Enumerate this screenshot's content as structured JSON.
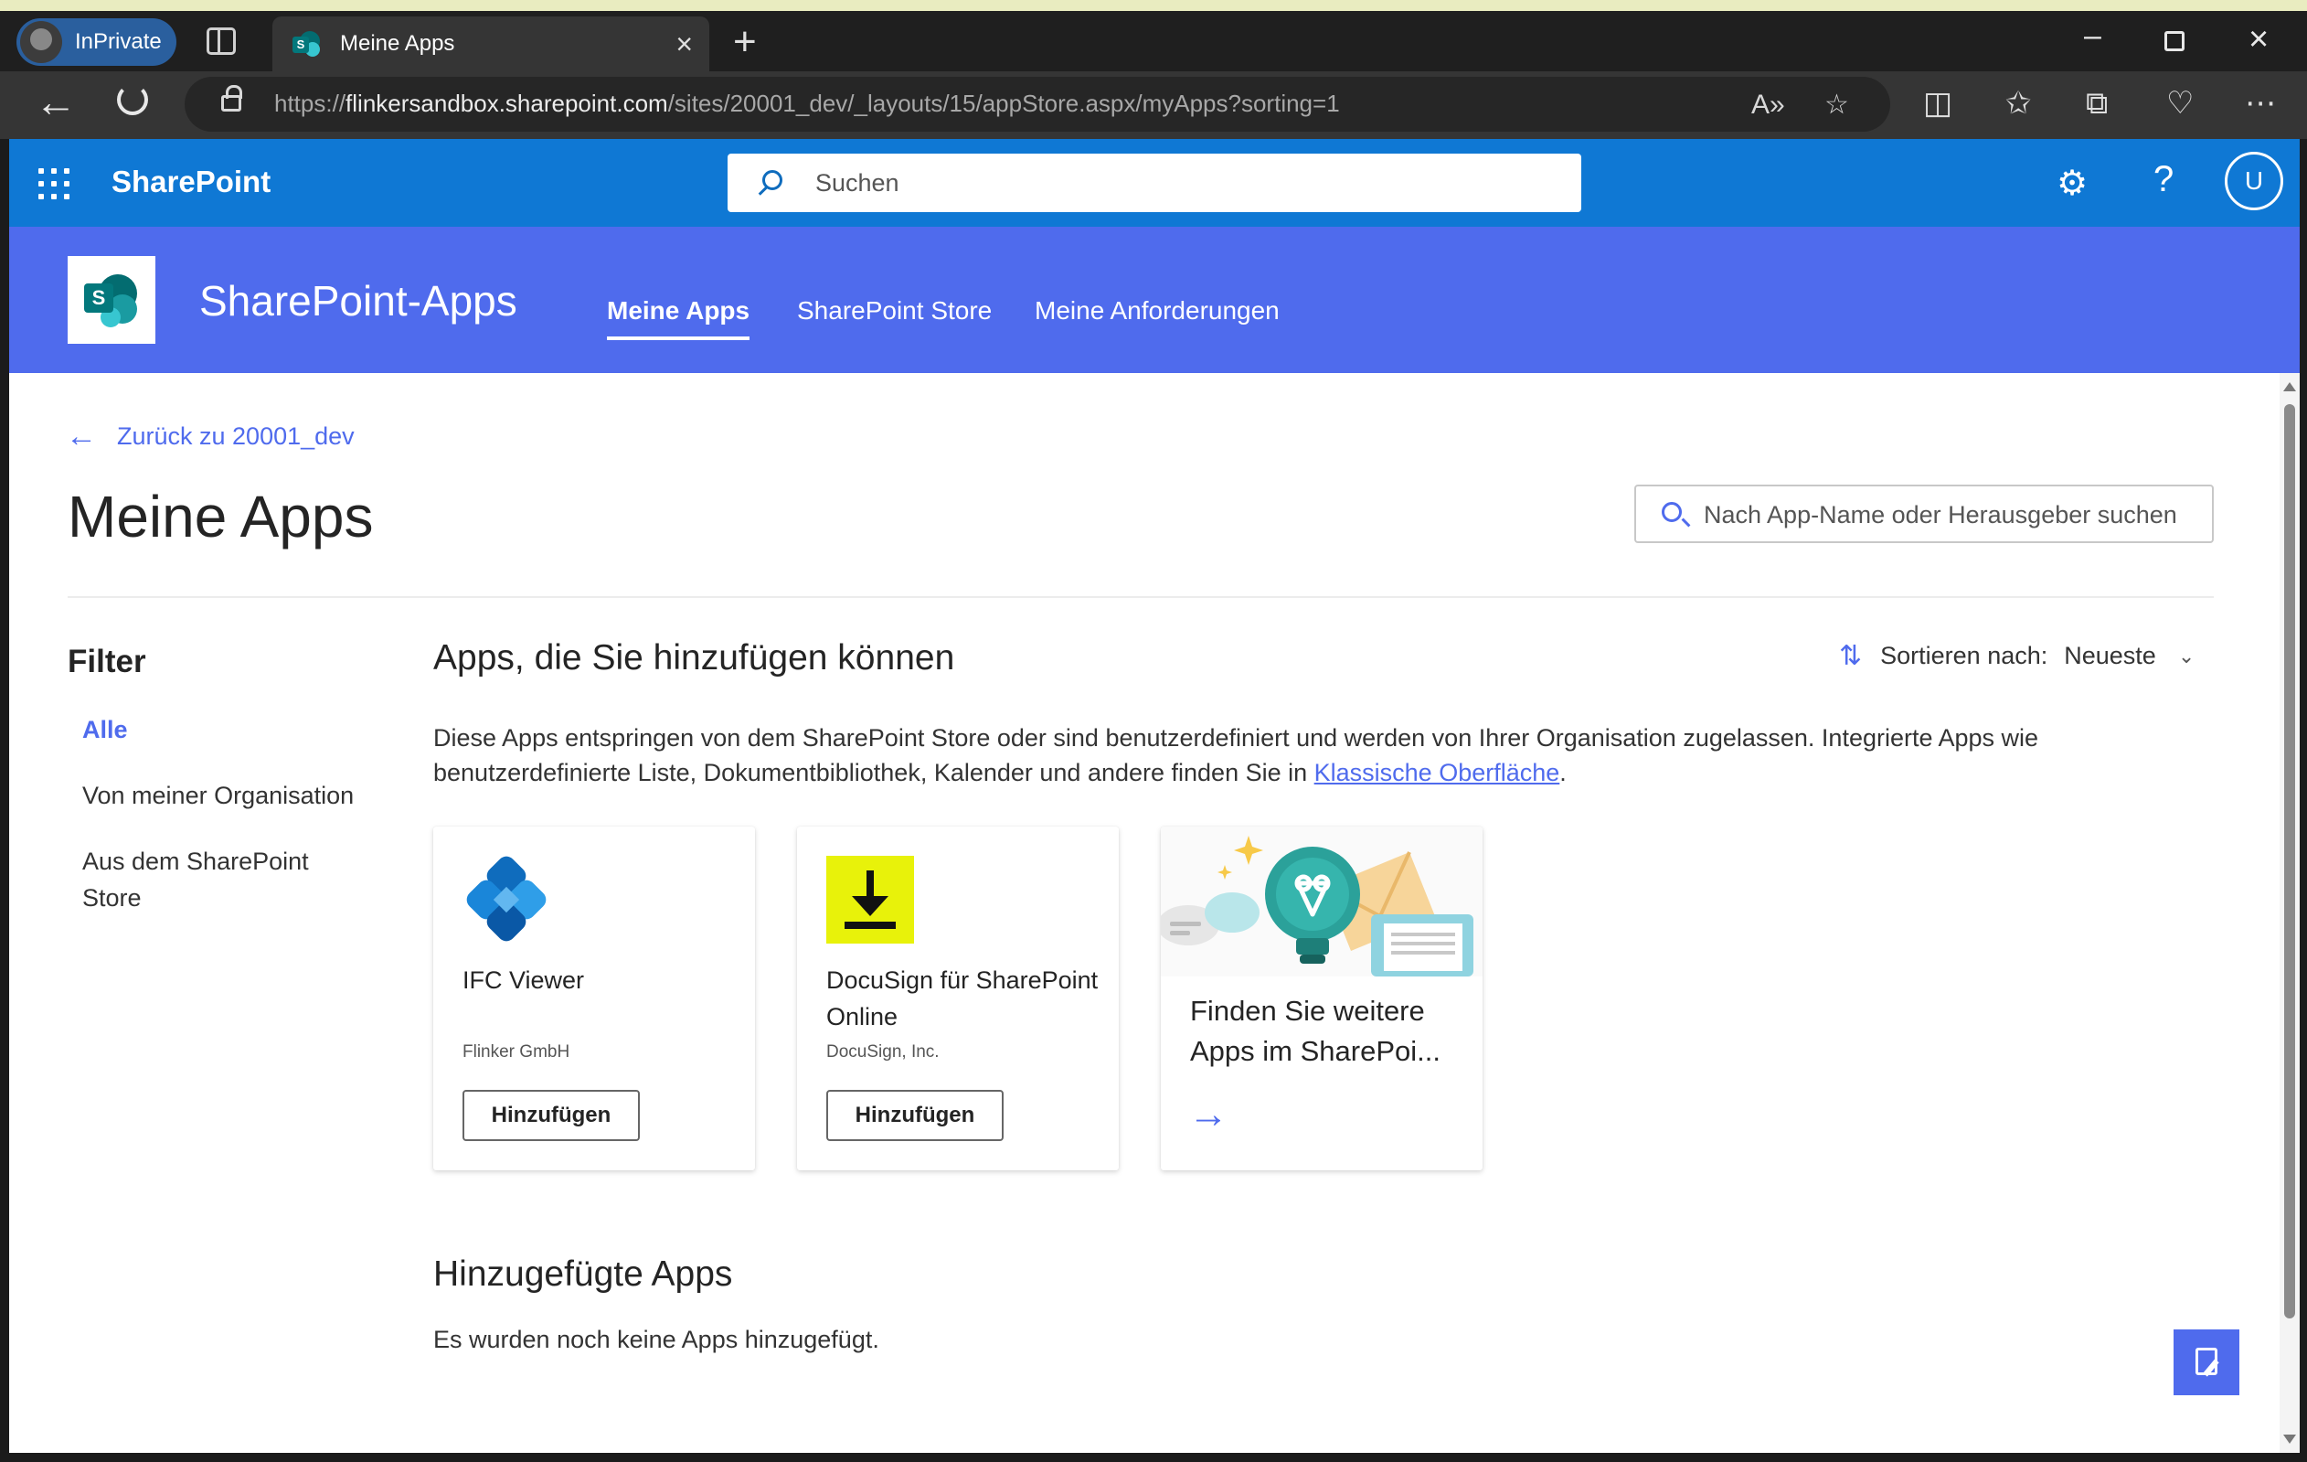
{
  "browser": {
    "profile_label": "InPrivate",
    "tab_title": "Meine Apps",
    "url_prefix": "https://",
    "url_domain": "flinkersandbox.sharepoint.com",
    "url_path": "/sites/20001_dev/_layouts/15/appStore.aspx/myApps?sorting=1"
  },
  "suite_bar": {
    "app_name": "SharePoint",
    "search_placeholder": "Suchen",
    "avatar_initial": "U"
  },
  "hub": {
    "title": "SharePoint-Apps",
    "nav": [
      {
        "label": "Meine Apps",
        "active": true
      },
      {
        "label": "SharePoint Store",
        "active": false
      },
      {
        "label": "Meine Anforderungen",
        "active": false
      }
    ]
  },
  "main": {
    "back_link": "Zurück zu 20001_dev",
    "page_title": "Meine Apps",
    "search_placeholder": "Nach App-Name oder Herausgeber suchen",
    "filter": {
      "heading": "Filter",
      "items": [
        {
          "label": "Alle",
          "active": true
        },
        {
          "label": "Von meiner Organisation",
          "active": false
        },
        {
          "label": "Aus dem SharePoint Store",
          "active": false
        }
      ]
    },
    "available": {
      "heading": "Apps, die Sie hinzufügen können",
      "sort_label": "Sortieren nach:",
      "sort_value": "Neueste",
      "description": "Diese Apps entspringen von dem SharePoint Store oder sind benutzerdefiniert und werden von Ihrer Organisation zugelassen. Integrierte Apps wie benutzerdefinierte Liste, Dokumentbibliothek, Kalender und andere finden Sie in ",
      "description_link": "Klassische Oberfläche",
      "description_end": ".",
      "apps": [
        {
          "name": "IFC Viewer",
          "publisher": "Flinker GmbH",
          "button": "Hinzufügen",
          "icon": "ifc-viewer-logo"
        },
        {
          "name": "DocuSign für SharePoint Online",
          "publisher": "DocuSign, Inc.",
          "button": "Hinzufügen",
          "icon": "docusign-logo"
        }
      ],
      "promo_text": "Finden Sie weitere Apps im SharePoi..."
    },
    "added": {
      "heading": "Hinzugefügte Apps",
      "empty_text": "Es wurden noch keine Apps hinzugefügt."
    }
  },
  "colors": {
    "suite_bar": "#0f78d4",
    "hub_header": "#4f6bed",
    "accent": "#4f6bed"
  }
}
